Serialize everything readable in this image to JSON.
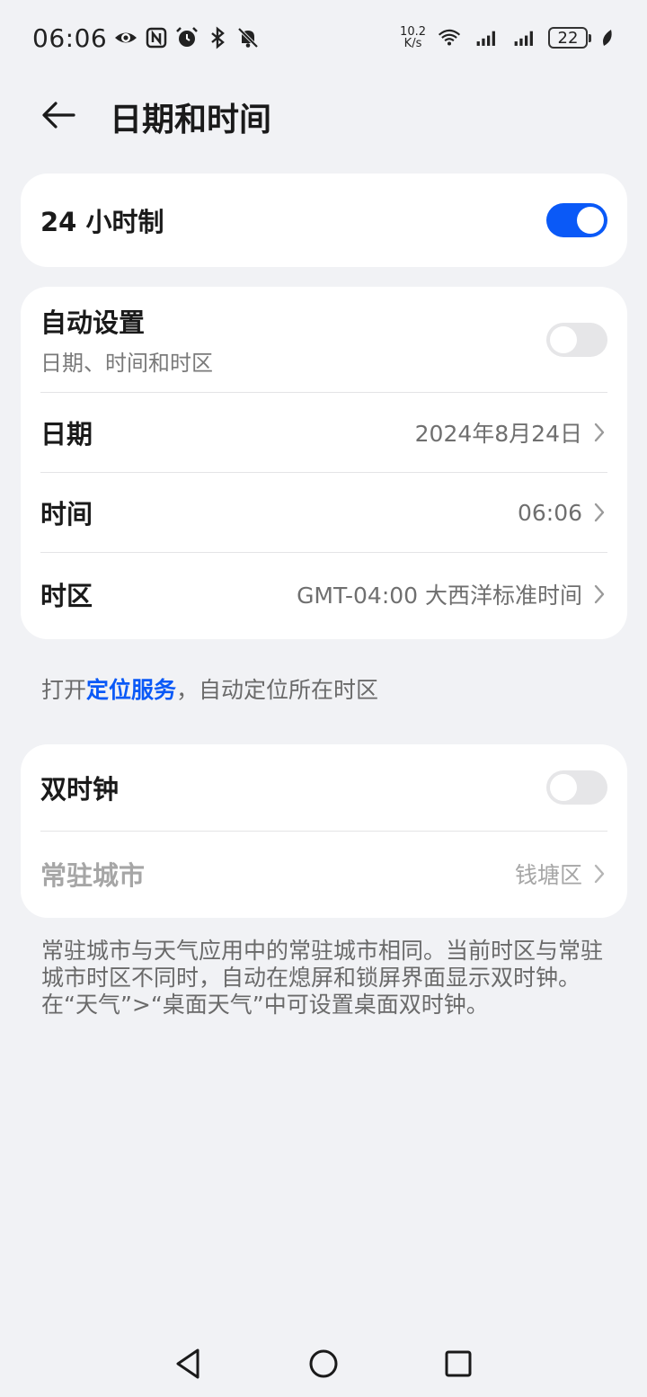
{
  "status_bar": {
    "time": "06:06",
    "net_speed_value": "10.2",
    "net_speed_unit": "K/s",
    "battery": "22",
    "icons": [
      "eye-icon",
      "nfc-icon",
      "alarm-icon",
      "bluetooth-icon",
      "mute-icon",
      "wifi-icon",
      "signal-icon",
      "signal-icon",
      "leaf-icon"
    ]
  },
  "header": {
    "title": "日期和时间"
  },
  "card_24h": {
    "label": "24 小时制",
    "enabled": true
  },
  "card_auto": {
    "auto_label": "自动设置",
    "auto_sub": "日期、时间和时区",
    "auto_enabled": false,
    "date_label": "日期",
    "date_value": "2024年8月24日",
    "time_label": "时间",
    "time_value": "06:06",
    "tz_label": "时区",
    "tz_value": "GMT-04:00 大西洋标准时间"
  },
  "location_hint": {
    "prefix": "打开",
    "link": "定位服务",
    "suffix": "，自动定位所在时区"
  },
  "card_dual": {
    "dual_label": "双时钟",
    "dual_enabled": false,
    "city_label": "常驻城市",
    "city_value": "钱塘区"
  },
  "footnote": "常驻城市与天气应用中的常驻城市相同。当前时区与常驻城市时区不同时，自动在熄屏和锁屏界面显示双时钟。在“天气”>“桌面天气”中可设置桌面双时钟。",
  "colors": {
    "accent": "#0a59f7",
    "background": "#f1f2f5",
    "card": "#ffffff"
  }
}
